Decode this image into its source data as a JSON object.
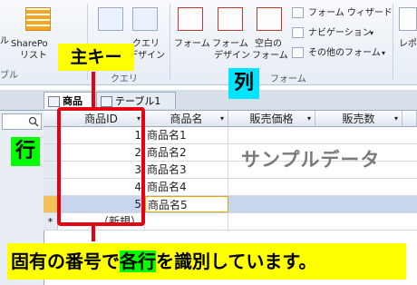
{
  "ribbon": {
    "left_cut_1": "ル",
    "left_cut_2": "ブル",
    "sharepoint_line1": "SharePo",
    "sharepoint_line2": "リスト",
    "query_design_line1": "クエリ",
    "query_design_line2": "デザイン",
    "query_group": "クエリ",
    "form": "フォーム",
    "form_design_line1": "フォーム",
    "form_design_line2": "デザイン",
    "blank_form_line1": "空白の",
    "blank_form_line2": "フォーム",
    "form_wizard": "フォーム ウィザード",
    "navigation": "ナビゲーション",
    "other_forms": "その他のフォーム",
    "forms_group": "フォーム",
    "report_cut": "レポー"
  },
  "tabs": [
    {
      "label": "商品"
    },
    {
      "label": "テーブル1"
    }
  ],
  "nav": {
    "search_icon": "search-icon",
    "collapse": "«"
  },
  "table": {
    "columns": [
      "商品ID",
      "商品名",
      "販売価格",
      "販売数"
    ],
    "rows": [
      {
        "id": "1",
        "name": "商品名1"
      },
      {
        "id": "2",
        "name": "商品名2"
      },
      {
        "id": "3",
        "name": "商品名3"
      },
      {
        "id": "4",
        "name": "商品名4"
      },
      {
        "id": "5",
        "name": "商品名5"
      }
    ],
    "new_record": "（新規）",
    "new_marker": "*"
  },
  "annotations": {
    "primary_key": "主キー",
    "column": "列",
    "row": "行",
    "sample": "サンプルデータ",
    "caption_part1": "固有の番号で",
    "caption_highlight": "各行",
    "caption_part2": "を識別しています。"
  },
  "colors": {
    "annotation_red": "#e60012",
    "highlight_yellow": "#ffff00",
    "highlight_green": "#00ff00",
    "highlight_cyan": "#00e5ff"
  }
}
